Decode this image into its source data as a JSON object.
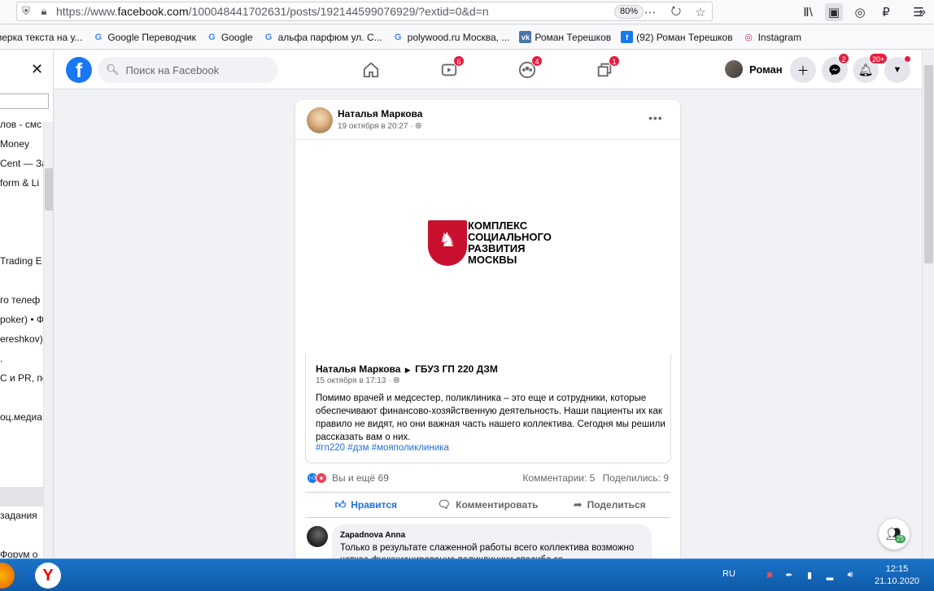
{
  "browser": {
    "url_prefix": "https://www.",
    "url_host": "facebook.com",
    "url_path": "/100048441702631/posts/192144599076929/?extid=0&d=n",
    "zoom": "80%"
  },
  "bookmarks": [
    {
      "label": "верка текста на у...",
      "icon": "doc-icon",
      "color": "#ffffff"
    },
    {
      "label": "Google Переводчик",
      "icon": "google-translate-icon",
      "color": "#4285f4"
    },
    {
      "label": "Google",
      "icon": "google-icon",
      "color": "#4285f4"
    },
    {
      "label": "альфа парфюм ул. С...",
      "icon": "google-icon",
      "color": "#4285f4"
    },
    {
      "label": "polywood.ru Москва, ...",
      "icon": "google-icon",
      "color": "#4285f4"
    },
    {
      "label": "Роман Терешков",
      "icon": "vk-icon",
      "color": "#4a76a8"
    },
    {
      "label": "(92) Роман Терешков",
      "icon": "facebook-icon",
      "color": "#1877f2"
    },
    {
      "label": "Instagram",
      "icon": "instagram-icon",
      "color": "#d62976"
    }
  ],
  "sidebar": {
    "rows": [
      "лов - смс",
      "Money",
      "Cent — За",
      "form & Li",
      "Trading E",
      "го телеф",
      "poker) • Ф",
      "ereshkov)",
      ".",
      "С и PR, по:",
      "оц.медиа:",
      "задания",
      "Форум о"
    ]
  },
  "fb": {
    "search_placeholder": "Поиск на Facebook",
    "badges": {
      "watch": "6",
      "groups": "4",
      "gaming": "1",
      "messenger": "2",
      "notifications": "20+"
    },
    "profile_name": "Роман"
  },
  "post": {
    "author": "Наталья Маркова",
    "time": "19 октября в 20:27 · ",
    "logo_lines": [
      "КОМПЛЕКС",
      "СОЦИАЛЬНОГО",
      "РАЗВИТИЯ",
      "МОСКВЫ"
    ],
    "shared": {
      "author": "Наталья Маркова",
      "target": "ГБУЗ ГП 220 ДЗМ",
      "time": "15 октября в 17:13 · ",
      "body": "Помимо врачей и медсестер, поликлиника – это еще и сотрудники, которые обеспечивают финансово-хозяйственную деятельность. Наши пациенты их как правило не видят, но они важная часть нашего коллектива. Сегодня мы решили рассказать вам о них.",
      "tags": "#гп220 #дзм #моя​поликлиника"
    },
    "reactions": "Вы и ещё 69",
    "comments_count": "Комментарии: 5",
    "shares_count": "Поделились: 9",
    "actions": {
      "like": "Нравится",
      "comment": "Комментировать",
      "share": "Поделиться"
    },
    "comment": {
      "name": "Zapadnova Anna",
      "text": "Только в результате слаженной работы всего коллектива возможно четкое функционирование поликлиники спасибо за"
    }
  },
  "contacts_count": "25",
  "taskbar": {
    "lang": "RU",
    "time": "12:15",
    "date": "21.10.2020"
  }
}
